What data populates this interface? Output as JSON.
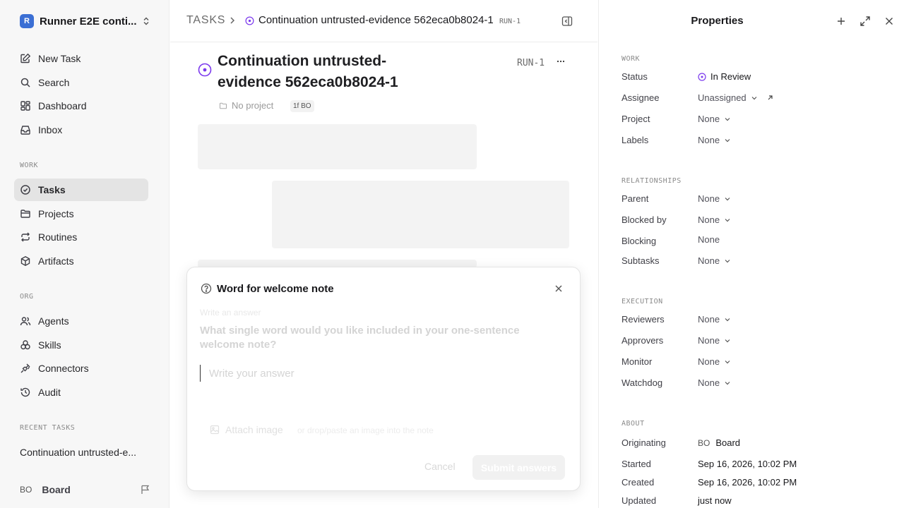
{
  "workspace": {
    "logo_letter": "R",
    "name": "Runner E2E conti..."
  },
  "sidebar": {
    "nav": [
      {
        "label": "New Task",
        "icon": "edit-icon"
      },
      {
        "label": "Search",
        "icon": "search-icon"
      },
      {
        "label": "Dashboard",
        "icon": "dashboard-icon"
      },
      {
        "label": "Inbox",
        "icon": "inbox-icon"
      }
    ],
    "work_label": "WORK",
    "work": [
      {
        "label": "Tasks",
        "icon": "check-circle-icon",
        "active": true
      },
      {
        "label": "Projects",
        "icon": "folder-icon"
      },
      {
        "label": "Routines",
        "icon": "repeat-icon"
      },
      {
        "label": "Artifacts",
        "icon": "box-icon"
      }
    ],
    "org_label": "ORG",
    "org": [
      {
        "label": "Agents",
        "icon": "users-icon"
      },
      {
        "label": "Skills",
        "icon": "skills-icon"
      },
      {
        "label": "Connectors",
        "icon": "plug-icon"
      },
      {
        "label": "Audit",
        "icon": "history-icon"
      }
    ],
    "recent_label": "RECENT TASKS",
    "recent": [
      "Continuation untrusted-e..."
    ],
    "user": {
      "initials": "BO",
      "name": "Board"
    }
  },
  "breadcrumb": {
    "root": "TASKS",
    "title": "Continuation untrusted-evidence 562eca0b8024-1",
    "id": "RUN-1"
  },
  "task": {
    "title": "Continuation untrusted-evidence 562eca0b8024-1",
    "id": "RUN-1",
    "project": "No project",
    "agent_badge": "1f BO"
  },
  "dialog": {
    "title": "Word for welcome note",
    "hint": "Write an answer",
    "question": "What single word would you like included in your one-sentence welcome note?",
    "input_placeholder": "Write your answer",
    "attach_label": "Attach image",
    "attach_hint": "or drop/paste an image into the note",
    "cancel_label": "Cancel",
    "submit_label": "Submit answers"
  },
  "properties": {
    "title": "Properties",
    "sections": {
      "work": "WORK",
      "relationships": "RELATIONSHIPS",
      "execution": "EXECUTION",
      "about": "ABOUT"
    },
    "status": {
      "label": "Status",
      "value": "In Review",
      "color": "#7c3aed"
    },
    "assignee": {
      "label": "Assignee",
      "value": "Unassigned"
    },
    "project": {
      "label": "Project",
      "value": "None"
    },
    "labels": {
      "label": "Labels",
      "value": "None"
    },
    "parent": {
      "label": "Parent",
      "value": "None"
    },
    "blocked_by": {
      "label": "Blocked by",
      "value": "None"
    },
    "blocking": {
      "label": "Blocking",
      "value": "None"
    },
    "subtasks": {
      "label": "Subtasks",
      "value": "None"
    },
    "reviewers": {
      "label": "Reviewers",
      "value": "None"
    },
    "approvers": {
      "label": "Approvers",
      "value": "None"
    },
    "monitor": {
      "label": "Monitor",
      "value": "None"
    },
    "watchdog": {
      "label": "Watchdog",
      "value": "None"
    },
    "originating": {
      "label": "Originating",
      "initials": "BO",
      "value": "Board"
    },
    "started": {
      "label": "Started",
      "value": "Sep 16, 2026, 10:02 PM"
    },
    "created": {
      "label": "Created",
      "value": "Sep 16, 2026, 10:02 PM"
    },
    "updated": {
      "label": "Updated",
      "value": "just now"
    }
  }
}
